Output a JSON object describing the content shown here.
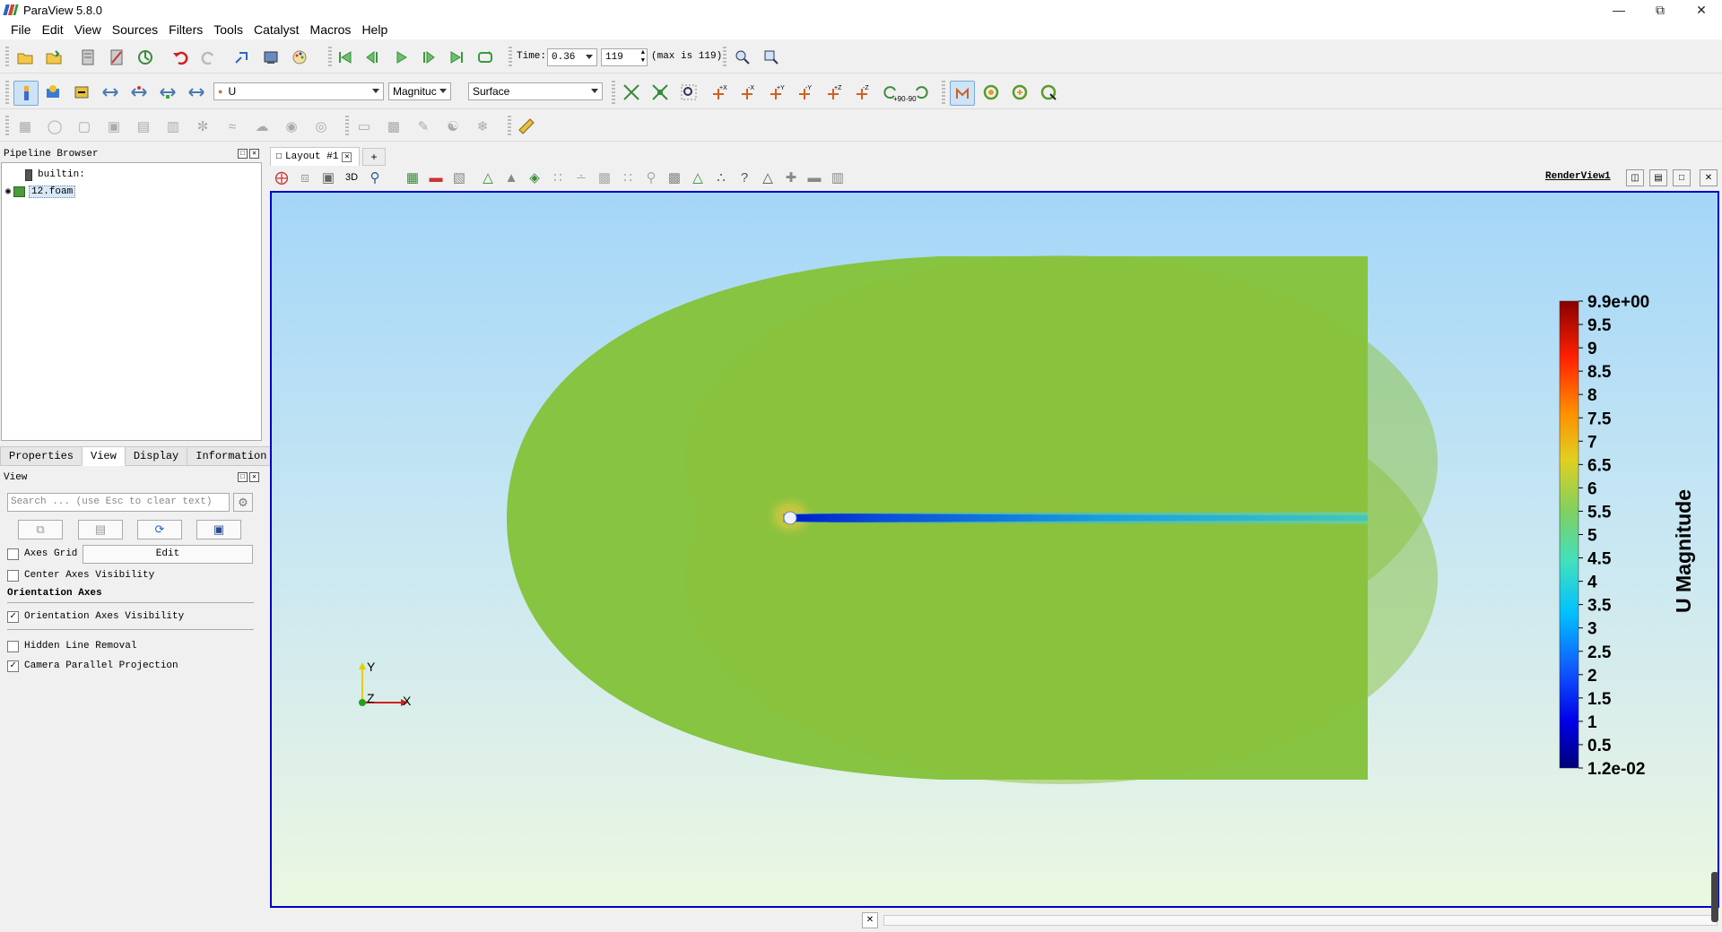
{
  "window": {
    "title": "ParaView 5.8.0"
  },
  "menubar": {
    "items": [
      "File",
      "Edit",
      "View",
      "Sources",
      "Filters",
      "Tools",
      "Catalyst",
      "Macros",
      "Help"
    ]
  },
  "toolbar": {
    "time_label": "Time:",
    "time_value": "0.36",
    "timestep_value": "119",
    "max_label": "(max is 119)",
    "array_select": "U",
    "component_select": "Magnituc",
    "representation_select": "Surface",
    "rotate_plus_label": "+90",
    "rotate_minus_label": "-90"
  },
  "pipeline_browser": {
    "header": "Pipeline Browser",
    "items": [
      "builtin:",
      "12.foam"
    ]
  },
  "panel_tabs": [
    "Properties",
    "View",
    "Display",
    "Information"
  ],
  "active_panel_tab": "View",
  "view_panel": {
    "header": "View",
    "search_placeholder": "Search ... (use Esc to clear text)",
    "axes_grid_label": "Axes Grid",
    "axes_grid_checked": false,
    "edit_label": "Edit",
    "center_axes_label": "Center Axes Visibility",
    "center_axes_checked": false,
    "orientation_section": "Orientation Axes",
    "orientation_visibility_label": "Orientation Axes Visibility",
    "orientation_visibility_checked": true,
    "hidden_line_label": "Hidden Line Removal",
    "hidden_line_checked": false,
    "parallel_projection_label": "Camera Parallel Projection",
    "parallel_projection_checked": true
  },
  "layout": {
    "tab_label": "Layout #1",
    "add_tab": "+",
    "render_view_name": "RenderView1",
    "view_mode_3d": "3D"
  },
  "colorbar": {
    "title": "U Magnitude",
    "labels": [
      "9.9e+00",
      "9.5",
      "9",
      "8.5",
      "8",
      "7.5",
      "7",
      "6.5",
      "6",
      "5.5",
      "5",
      "4.5",
      "4",
      "3.5",
      "3",
      "2.5",
      "2",
      "1.5",
      "1",
      "0.5",
      "1.2e-02"
    ],
    "range": [
      0.012,
      9.9
    ]
  },
  "orientation_axes": {
    "x": "X",
    "y": "Y",
    "z": "Z"
  },
  "colors": {
    "domain_green": "#86c441",
    "wake_blue": "#1060d8",
    "viewport_border": "#0000c8"
  }
}
